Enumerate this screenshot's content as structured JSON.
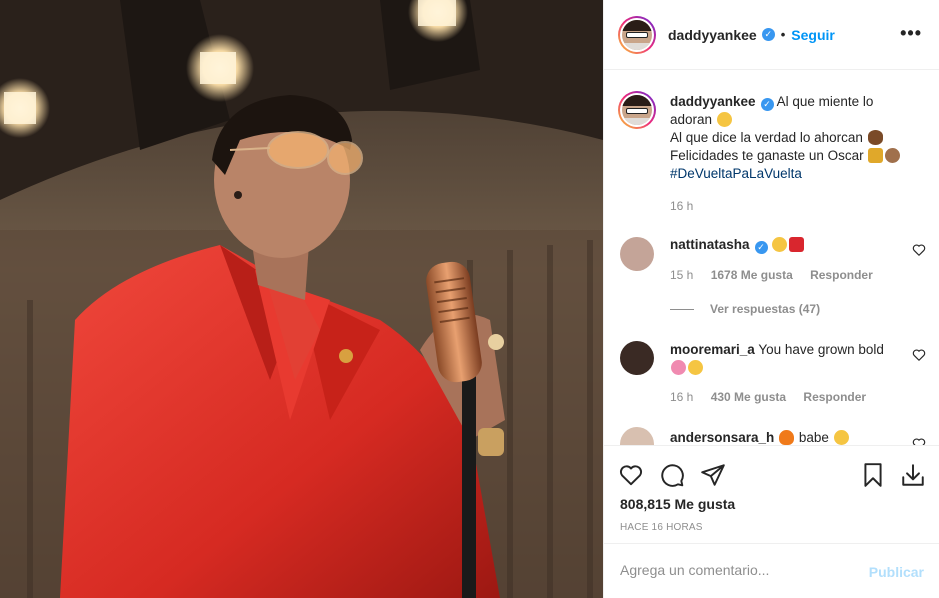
{
  "post": {
    "author": "daddyyankee",
    "follow_label": "Seguir",
    "more_icon": "more-horizontal-icon"
  },
  "caption": {
    "author": "daddyyankee",
    "line1": "Al que miente lo adoran",
    "line2": "Al que dice la verdad lo ahorcan",
    "line3": "Felicidades te ganaste un Oscar",
    "hashtag": "#DeVueltaPaLaVuelta",
    "time": "16 h"
  },
  "comments": [
    {
      "user": "nattinatasha",
      "text": "",
      "time": "15 h",
      "likes": "1678 Me gusta",
      "reply": "Responder"
    },
    {
      "user": "mooremari_a",
      "text": "You have grown bold",
      "time": "16 h",
      "likes": "430 Me gusta",
      "reply": "Responder"
    },
    {
      "user": "andersonsara_h",
      "text": "babe"
    }
  ],
  "view_replies": "Ver respuestas (47)",
  "actions": {
    "likes": "808,815 Me gusta",
    "time": "HACE 16 HORAS",
    "icons": [
      "heart-icon",
      "comment-icon",
      "share-icon",
      "bookmark-icon",
      "download-icon"
    ]
  },
  "add_comment": {
    "placeholder": "Agrega un comentario...",
    "publish_label": "Publicar"
  },
  "colors": {
    "accent": "#0095f6",
    "verified": "#3897f0",
    "muted": "#8e8e8e",
    "suit": "#e3342c"
  }
}
